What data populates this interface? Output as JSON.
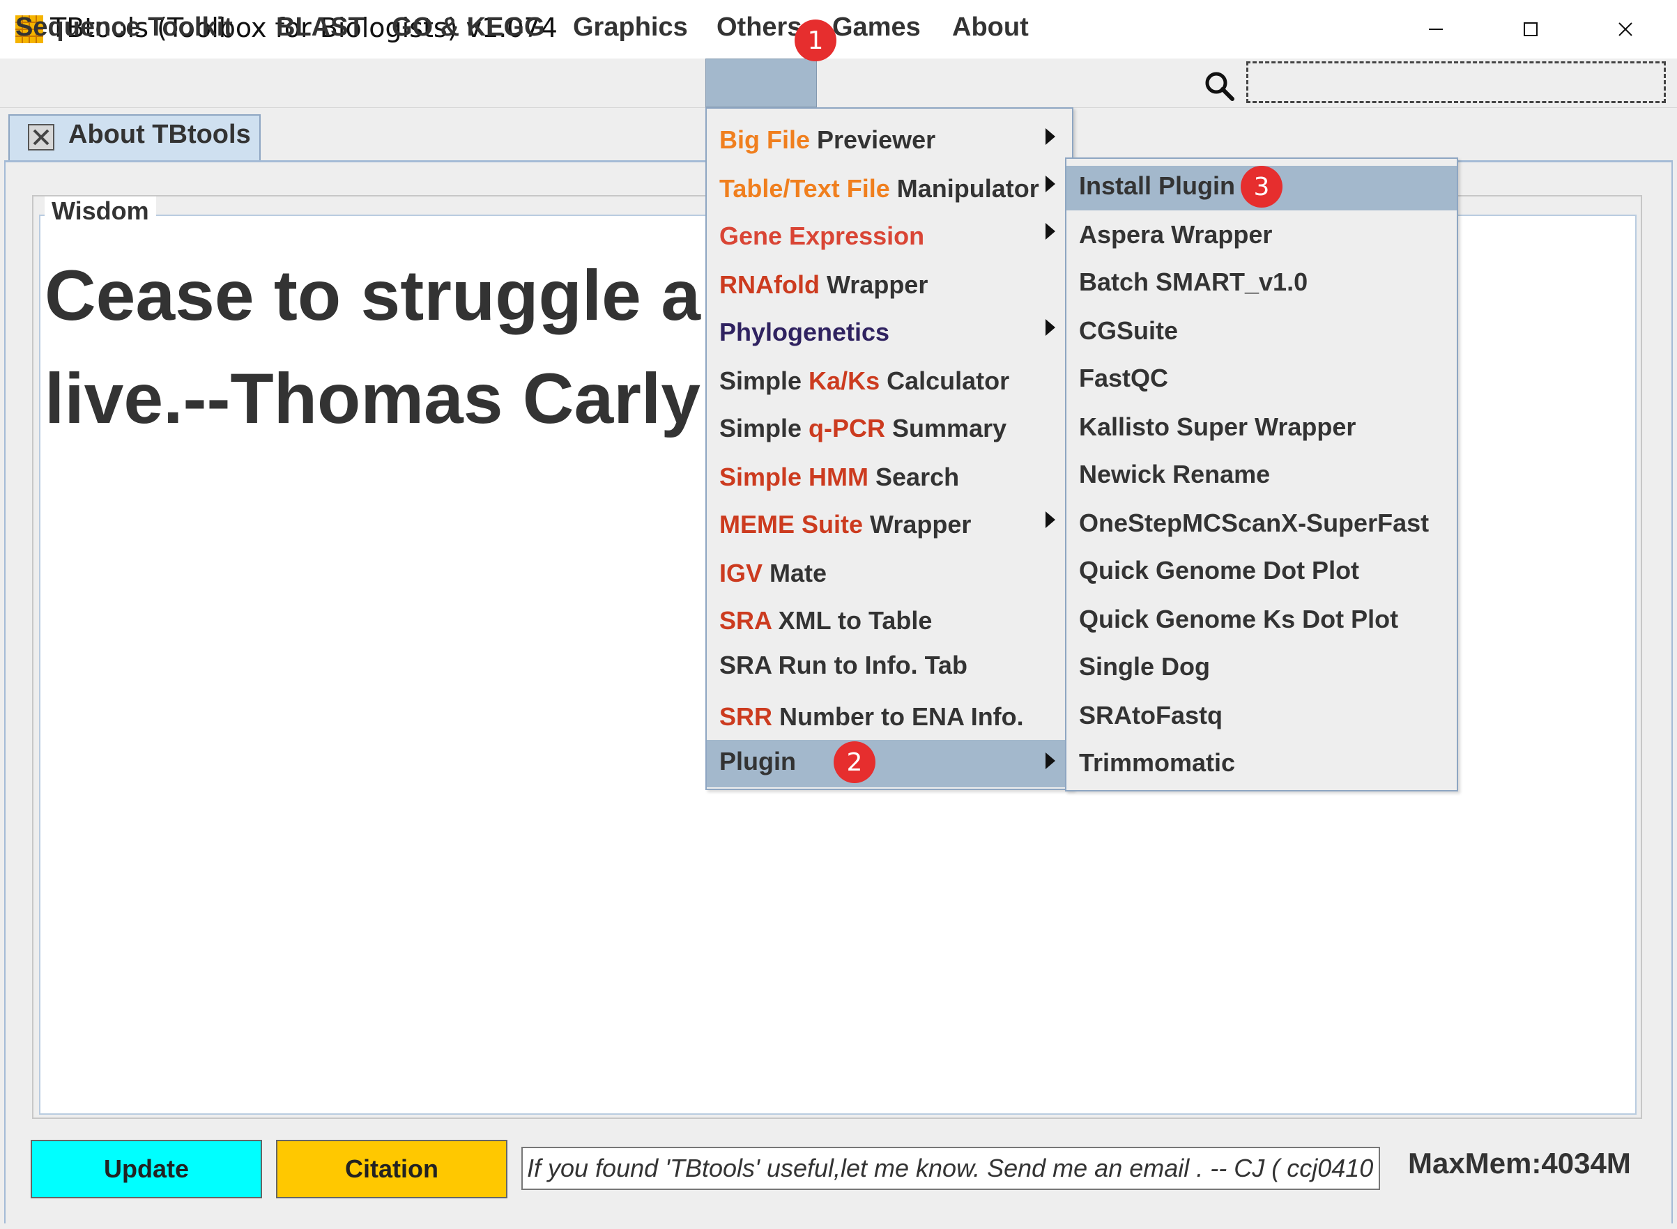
{
  "window": {
    "title": "TBtools (Toolbox for Biologists) v1.074",
    "minimize_glyph": "—",
    "maximize_glyph": "☐",
    "close_glyph": "✕"
  },
  "menubar": {
    "items": [
      "Sequence Toolkit",
      "BLAST",
      "GO & KEGG",
      "Graphics",
      "Others",
      "Games",
      "About"
    ],
    "search_placeholder": ""
  },
  "tabs": [
    {
      "label": "About TBtools"
    }
  ],
  "wisdom": {
    "label": "Wisdom",
    "quote_line1": "Cease to struggle a",
    "quote_line2": "live.--Thomas Carly"
  },
  "bottom": {
    "update_label": "Update",
    "citation_label": "Citation",
    "message": "If you found 'TBtools' useful,let me know. Send me an email . -- CJ   ( ccj0410",
    "maxmem": "MaxMem:4034M"
  },
  "others_menu": [
    {
      "part1": "Big File",
      "part2": " Previewer",
      "has_submenu": true
    },
    {
      "part1": "Table/Text File",
      "part2": " Manipulator",
      "has_submenu": true
    },
    {
      "part1": "Gene Expression",
      "part2": "",
      "has_submenu": true
    },
    {
      "part1": "RNAfold",
      "part2": " Wrapper",
      "has_submenu": false
    },
    {
      "part1": "Phylogenetics",
      "part2": "",
      "has_submenu": true
    },
    {
      "part1": "Simple ",
      "part2": "Ka/Ks",
      "part3": " Calculator",
      "has_submenu": false
    },
    {
      "part1": "Simple ",
      "part2": "q-PCR",
      "part3": " Summary",
      "has_submenu": false
    },
    {
      "part1": "Simple HMM",
      "part2": " Search",
      "has_submenu": false
    },
    {
      "part1": "MEME Suite",
      "part2": " Wrapper",
      "has_submenu": true
    },
    {
      "part1": "IGV",
      "part2": " Mate",
      "has_submenu": false
    },
    {
      "part1": "SRA",
      "part2": " XML to Table",
      "has_submenu": false
    },
    {
      "part1": "SRA Run to Info. Tab",
      "part2": "",
      "has_submenu": false
    },
    {
      "part1": "SRR",
      "part2": " Number to ENA Info.",
      "has_submenu": false
    },
    {
      "part1": "Plugin",
      "part2": "",
      "has_submenu": true
    }
  ],
  "plugin_submenu": [
    "Install Plugin",
    "Aspera Wrapper",
    "Batch SMART_v1.0",
    "CGSuite",
    "FastQC",
    "Kallisto Super Wrapper",
    "Newick Rename",
    "OneStepMCScanX-SuperFast",
    "Quick Genome Dot Plot",
    "Quick Genome Ks Dot Plot",
    "Single Dog",
    "SRAtoFastq",
    "Trimmomatic"
  ],
  "markers": [
    "1",
    "2",
    "3"
  ],
  "colors": {
    "menu_highlight": "#a3b8cc",
    "update_button": "#00ffff",
    "citation_button": "#ffc800",
    "marker_red": "#e62e2e",
    "label_orange": "#f07f1e",
    "label_red": "#d94535"
  }
}
